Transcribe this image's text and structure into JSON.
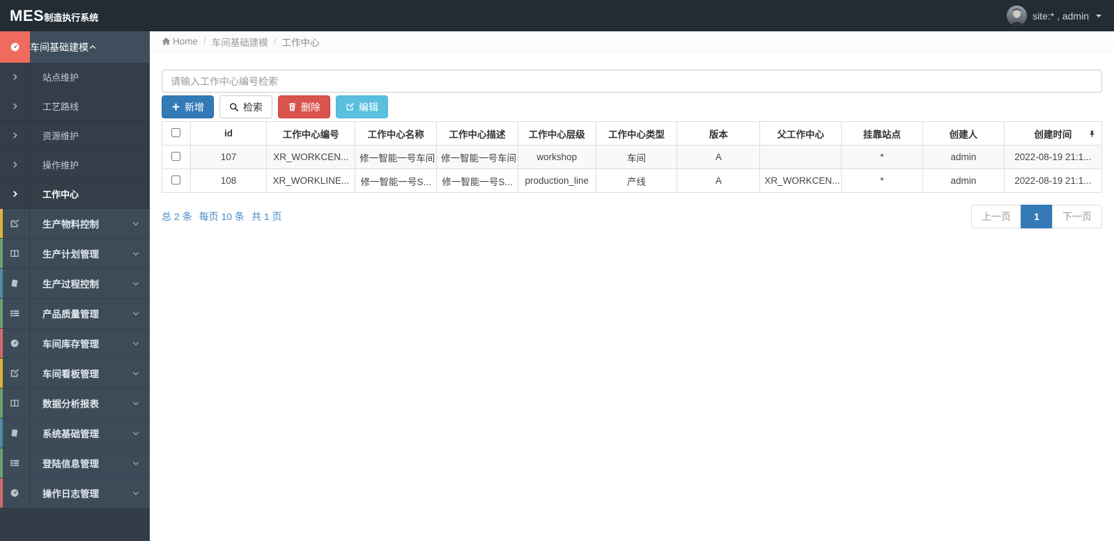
{
  "app": {
    "title_short": "MES",
    "title_rest": "制造执行系统"
  },
  "topbar": {
    "user": "site:* , admin"
  },
  "breadcrumb": {
    "home": "Home",
    "sep": "/",
    "parent": "车间基础建模",
    "current": "工作中心"
  },
  "sidebar": {
    "parent_active": {
      "label": "车间基础建模",
      "icon": "dashboard-icon",
      "icon_bg": "#ef6b5d"
    },
    "submenu": [
      {
        "label": "站点维护"
      },
      {
        "label": "工艺路线"
      },
      {
        "label": "资源维护"
      },
      {
        "label": "操作维护"
      },
      {
        "label": "工作中心",
        "active": true
      }
    ],
    "items": [
      {
        "label": "生产物料控制",
        "icon": "edit-icon",
        "strip": "#dcb43c"
      },
      {
        "label": "生产计划管理",
        "icon": "columns-icon",
        "strip": "#6aa06a"
      },
      {
        "label": "生产过程控制",
        "icon": "book-icon",
        "strip": "#4f8ba6"
      },
      {
        "label": "产品质量管理",
        "icon": "list-icon",
        "strip": "#6aa06a"
      },
      {
        "label": "车间库存管理",
        "icon": "dashboard-icon",
        "strip": "#cf6a6a"
      },
      {
        "label": "车间看板管理",
        "icon": "edit-icon",
        "strip": "#dcb43c"
      },
      {
        "label": "数据分析报表",
        "icon": "columns-icon",
        "strip": "#6aa06a"
      },
      {
        "label": "系统基础管理",
        "icon": "book-icon",
        "strip": "#4f8ba6"
      },
      {
        "label": "登陆信息管理",
        "icon": "list-icon",
        "strip": "#6aa06a"
      },
      {
        "label": "操作日志管理",
        "icon": "dashboard-icon",
        "strip": "#cf6a6a"
      }
    ]
  },
  "search": {
    "placeholder": "请输入工作中心编号检索",
    "value": ""
  },
  "toolbar": {
    "add": "新增",
    "search": "检索",
    "delete": "删除",
    "edit": "编辑"
  },
  "table": {
    "columns": [
      "id",
      "工作中心编号",
      "工作中心名称",
      "工作中心描述",
      "工作中心层级",
      "工作中心类型",
      "版本",
      "父工作中心",
      "挂靠站点",
      "创建人",
      "创建时间"
    ],
    "rows": [
      {
        "id": "107",
        "code": "XR_WORKCEN...",
        "name": "修一智能一号车间",
        "desc": "修一智能一号车间",
        "level": "workshop",
        "type": "车间",
        "version": "A",
        "parent": "",
        "station": "*",
        "creator": "admin",
        "created": "2022-08-19 21:1..."
      },
      {
        "id": "108",
        "code": "XR_WORKLINE...",
        "name": "修一智能一号S...",
        "desc": "修一智能一号S...",
        "level": "production_line",
        "type": "产线",
        "version": "A",
        "parent": "XR_WORKCEN...",
        "station": "*",
        "creator": "admin",
        "created": "2022-08-19 21:1..."
      }
    ]
  },
  "pagination": {
    "summary_total": "总 2 条",
    "summary_pagesize": "每页 10 条",
    "summary_pages": "共 1 页",
    "prev": "上一页",
    "page": "1",
    "next": "下一页"
  },
  "colors": {
    "topbar": "#222c35",
    "sidebar_item": "#3d4b59",
    "sidebar_submenu": "#333e49",
    "active_icon_bg": "#ef6b5d",
    "primary": "#337ab7",
    "danger": "#d9534f",
    "info": "#5bc0de",
    "link": "#428bca",
    "stripe_row": "#f9f9f9"
  }
}
